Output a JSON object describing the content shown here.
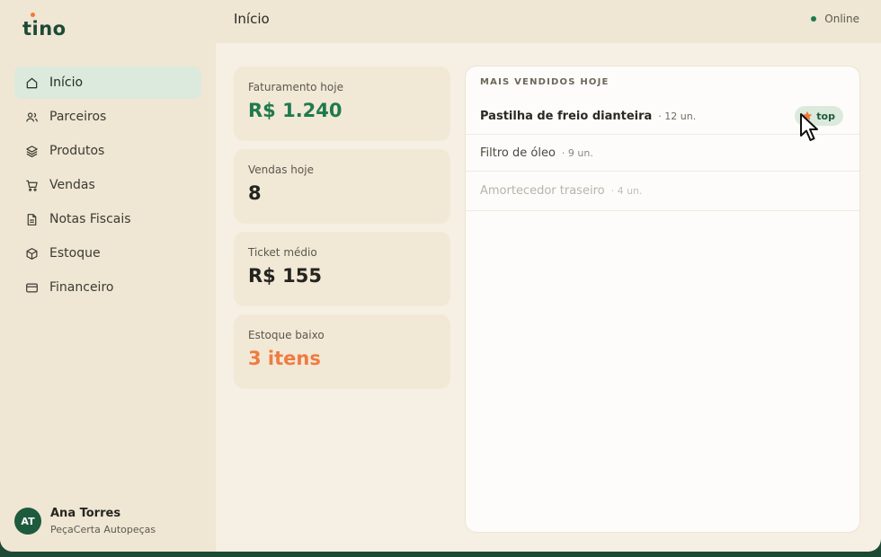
{
  "app": {
    "logo": "tino",
    "colors": {
      "brand": "#1c4a35",
      "accent": "#ef7a3a",
      "active": "#dbeadc"
    }
  },
  "header": {
    "title": "Início",
    "status": "Online"
  },
  "sidebar": {
    "items": [
      {
        "label": "Início",
        "icon": "home-icon",
        "active": true
      },
      {
        "label": "Parceiros",
        "icon": "users-icon"
      },
      {
        "label": "Produtos",
        "icon": "layers-icon"
      },
      {
        "label": "Vendas",
        "icon": "cart-icon"
      },
      {
        "label": "Notas Fiscais",
        "icon": "document-icon"
      },
      {
        "label": "Estoque",
        "icon": "box-icon"
      },
      {
        "label": "Financeiro",
        "icon": "card-icon"
      }
    ],
    "user": {
      "initials": "AT",
      "name": "Ana Torres",
      "company": "PeçaCerta Autopeças"
    }
  },
  "stats": [
    {
      "label": "Faturamento hoje",
      "value": "R$ 1.240"
    },
    {
      "label": "Vendas hoje",
      "value": "8"
    },
    {
      "label": "Ticket médio",
      "value": "R$ 155"
    },
    {
      "label": "Estoque baixo",
      "value": "3 itens"
    }
  ],
  "best_sellers": {
    "title": "MAIS VENDIDOS HOJE",
    "rows": [
      {
        "name": "Pastilha de freio dianteira",
        "qty": "· 12 un.",
        "badge": "top"
      },
      {
        "name": "Filtro de óleo",
        "qty": "· 9 un."
      },
      {
        "name": "Amortecedor traseiro",
        "qty": "· 4 un."
      }
    ]
  }
}
